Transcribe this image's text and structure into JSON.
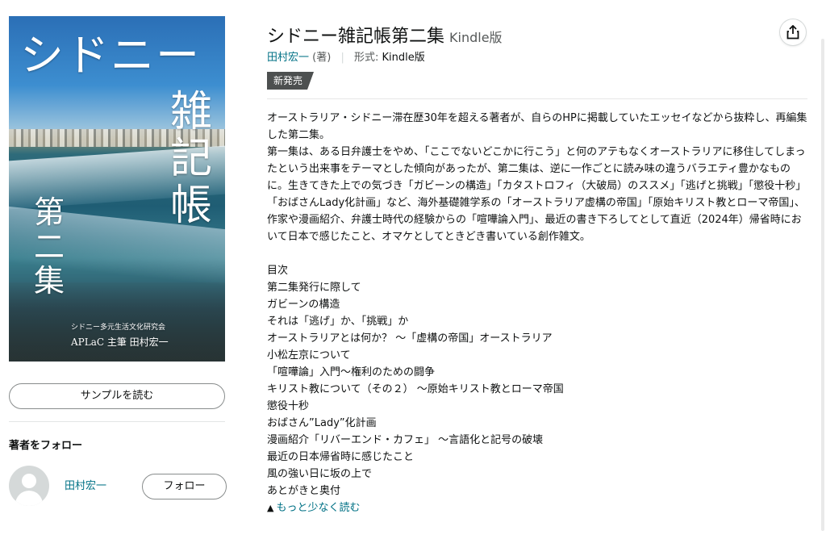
{
  "cover": {
    "title_line": "シドニー",
    "title_vertical_1": "雑記帳",
    "title_vertical_2": "第二集",
    "publisher": "シドニー多元生活文化研究会",
    "author_line": "APLaC 主筆 田村宏一"
  },
  "sidebar": {
    "sample_label": "サンプルを読む",
    "follow_heading": "著者をフォロー",
    "author_name": "田村宏一",
    "follow_label": "フォロー"
  },
  "product": {
    "title": "シドニー雑記帳第二集",
    "format_title": "Kindle版",
    "author": "田村宏一",
    "author_role": "(著)",
    "format_label": "形式:",
    "format_value": "Kindle版",
    "badge": "新発売",
    "description": [
      "オーストラリア・シドニー滞在歴30年を超える著者が、自らのHPに掲載していたエッセイなどから抜粋し、再編集した第二集。",
      "第一集は、ある日弁護士をやめ、「ここでないどこかに行こう」と何のアテもなくオーストラリアに移住してしまったという出来事をテーマとした傾向があったが、第二集は、逆に一作ごとに読み味の違うバラエティ豊かなものに。生きてきた上での気づき「ガビーンの構造」「カタストロフィ（大破局）のススメ」「逃げと挑戦」「懲役十秒」「おばさんLady化計画」など、海外基礎雑学系の「オーストラリア虚構の帝国」「原始キリスト教とローマ帝国」、作家や漫画紹介、弁護士時代の経験からの「喧嘩論入門」、最近の書き下ろしてとして直近（2024年）帰省時において日本で感じたこと、オマケとしてときどき書いている創作雑文。"
    ],
    "toc_heading": "目次",
    "toc": [
      "第二集発行に際して",
      "ガビーンの構造",
      "それは「逃げ」か、「挑戦」か",
      "オーストラリアとは何か？ ～「虚構の帝国」オーストラリア",
      "小松左京について",
      "「喧嘩論」入門～権利のための闘争",
      "キリスト教について（その２） ～原始キリスト教とローマ帝国",
      "懲役十秒",
      "おばさん”Lady”化計画",
      "漫画紹介「リバーエンド・カフェ」 ～言語化と記号の破壊",
      "最近の日本帰省時に感じたこと",
      "風の強い日に坂の上で",
      "あとがきと奥付"
    ],
    "read_less": "もっと少なく読む"
  },
  "icons": {
    "share": "share-icon",
    "chevron": "chevron-up-icon",
    "avatar": "default-avatar-icon"
  },
  "colors": {
    "link": "#007185",
    "badge_bg": "#4d5050",
    "text": "#0f1111",
    "muted": "#565959"
  }
}
